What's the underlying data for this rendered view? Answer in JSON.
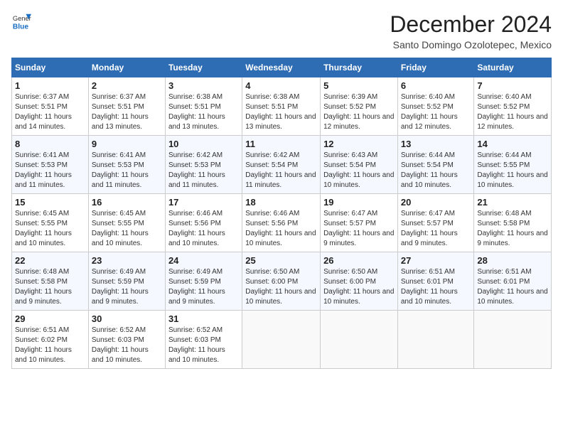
{
  "header": {
    "logo_general": "General",
    "logo_blue": "Blue",
    "title": "December 2024",
    "location": "Santo Domingo Ozolotepec, Mexico"
  },
  "weekdays": [
    "Sunday",
    "Monday",
    "Tuesday",
    "Wednesday",
    "Thursday",
    "Friday",
    "Saturday"
  ],
  "weeks": [
    [
      {
        "day": "1",
        "content": "Sunrise: 6:37 AM\nSunset: 5:51 PM\nDaylight: 11 hours and 14 minutes."
      },
      {
        "day": "2",
        "content": "Sunrise: 6:37 AM\nSunset: 5:51 PM\nDaylight: 11 hours and 13 minutes."
      },
      {
        "day": "3",
        "content": "Sunrise: 6:38 AM\nSunset: 5:51 PM\nDaylight: 11 hours and 13 minutes."
      },
      {
        "day": "4",
        "content": "Sunrise: 6:38 AM\nSunset: 5:51 PM\nDaylight: 11 hours and 13 minutes."
      },
      {
        "day": "5",
        "content": "Sunrise: 6:39 AM\nSunset: 5:52 PM\nDaylight: 11 hours and 12 minutes."
      },
      {
        "day": "6",
        "content": "Sunrise: 6:40 AM\nSunset: 5:52 PM\nDaylight: 11 hours and 12 minutes."
      },
      {
        "day": "7",
        "content": "Sunrise: 6:40 AM\nSunset: 5:52 PM\nDaylight: 11 hours and 12 minutes."
      }
    ],
    [
      {
        "day": "8",
        "content": "Sunrise: 6:41 AM\nSunset: 5:53 PM\nDaylight: 11 hours and 11 minutes."
      },
      {
        "day": "9",
        "content": "Sunrise: 6:41 AM\nSunset: 5:53 PM\nDaylight: 11 hours and 11 minutes."
      },
      {
        "day": "10",
        "content": "Sunrise: 6:42 AM\nSunset: 5:53 PM\nDaylight: 11 hours and 11 minutes."
      },
      {
        "day": "11",
        "content": "Sunrise: 6:42 AM\nSunset: 5:54 PM\nDaylight: 11 hours and 11 minutes."
      },
      {
        "day": "12",
        "content": "Sunrise: 6:43 AM\nSunset: 5:54 PM\nDaylight: 11 hours and 10 minutes."
      },
      {
        "day": "13",
        "content": "Sunrise: 6:44 AM\nSunset: 5:54 PM\nDaylight: 11 hours and 10 minutes."
      },
      {
        "day": "14",
        "content": "Sunrise: 6:44 AM\nSunset: 5:55 PM\nDaylight: 11 hours and 10 minutes."
      }
    ],
    [
      {
        "day": "15",
        "content": "Sunrise: 6:45 AM\nSunset: 5:55 PM\nDaylight: 11 hours and 10 minutes."
      },
      {
        "day": "16",
        "content": "Sunrise: 6:45 AM\nSunset: 5:55 PM\nDaylight: 11 hours and 10 minutes."
      },
      {
        "day": "17",
        "content": "Sunrise: 6:46 AM\nSunset: 5:56 PM\nDaylight: 11 hours and 10 minutes."
      },
      {
        "day": "18",
        "content": "Sunrise: 6:46 AM\nSunset: 5:56 PM\nDaylight: 11 hours and 10 minutes."
      },
      {
        "day": "19",
        "content": "Sunrise: 6:47 AM\nSunset: 5:57 PM\nDaylight: 11 hours and 9 minutes."
      },
      {
        "day": "20",
        "content": "Sunrise: 6:47 AM\nSunset: 5:57 PM\nDaylight: 11 hours and 9 minutes."
      },
      {
        "day": "21",
        "content": "Sunrise: 6:48 AM\nSunset: 5:58 PM\nDaylight: 11 hours and 9 minutes."
      }
    ],
    [
      {
        "day": "22",
        "content": "Sunrise: 6:48 AM\nSunset: 5:58 PM\nDaylight: 11 hours and 9 minutes."
      },
      {
        "day": "23",
        "content": "Sunrise: 6:49 AM\nSunset: 5:59 PM\nDaylight: 11 hours and 9 minutes."
      },
      {
        "day": "24",
        "content": "Sunrise: 6:49 AM\nSunset: 5:59 PM\nDaylight: 11 hours and 9 minutes."
      },
      {
        "day": "25",
        "content": "Sunrise: 6:50 AM\nSunset: 6:00 PM\nDaylight: 11 hours and 10 minutes."
      },
      {
        "day": "26",
        "content": "Sunrise: 6:50 AM\nSunset: 6:00 PM\nDaylight: 11 hours and 10 minutes."
      },
      {
        "day": "27",
        "content": "Sunrise: 6:51 AM\nSunset: 6:01 PM\nDaylight: 11 hours and 10 minutes."
      },
      {
        "day": "28",
        "content": "Sunrise: 6:51 AM\nSunset: 6:01 PM\nDaylight: 11 hours and 10 minutes."
      }
    ],
    [
      {
        "day": "29",
        "content": "Sunrise: 6:51 AM\nSunset: 6:02 PM\nDaylight: 11 hours and 10 minutes."
      },
      {
        "day": "30",
        "content": "Sunrise: 6:52 AM\nSunset: 6:03 PM\nDaylight: 11 hours and 10 minutes."
      },
      {
        "day": "31",
        "content": "Sunrise: 6:52 AM\nSunset: 6:03 PM\nDaylight: 11 hours and 10 minutes."
      },
      null,
      null,
      null,
      null
    ]
  ]
}
